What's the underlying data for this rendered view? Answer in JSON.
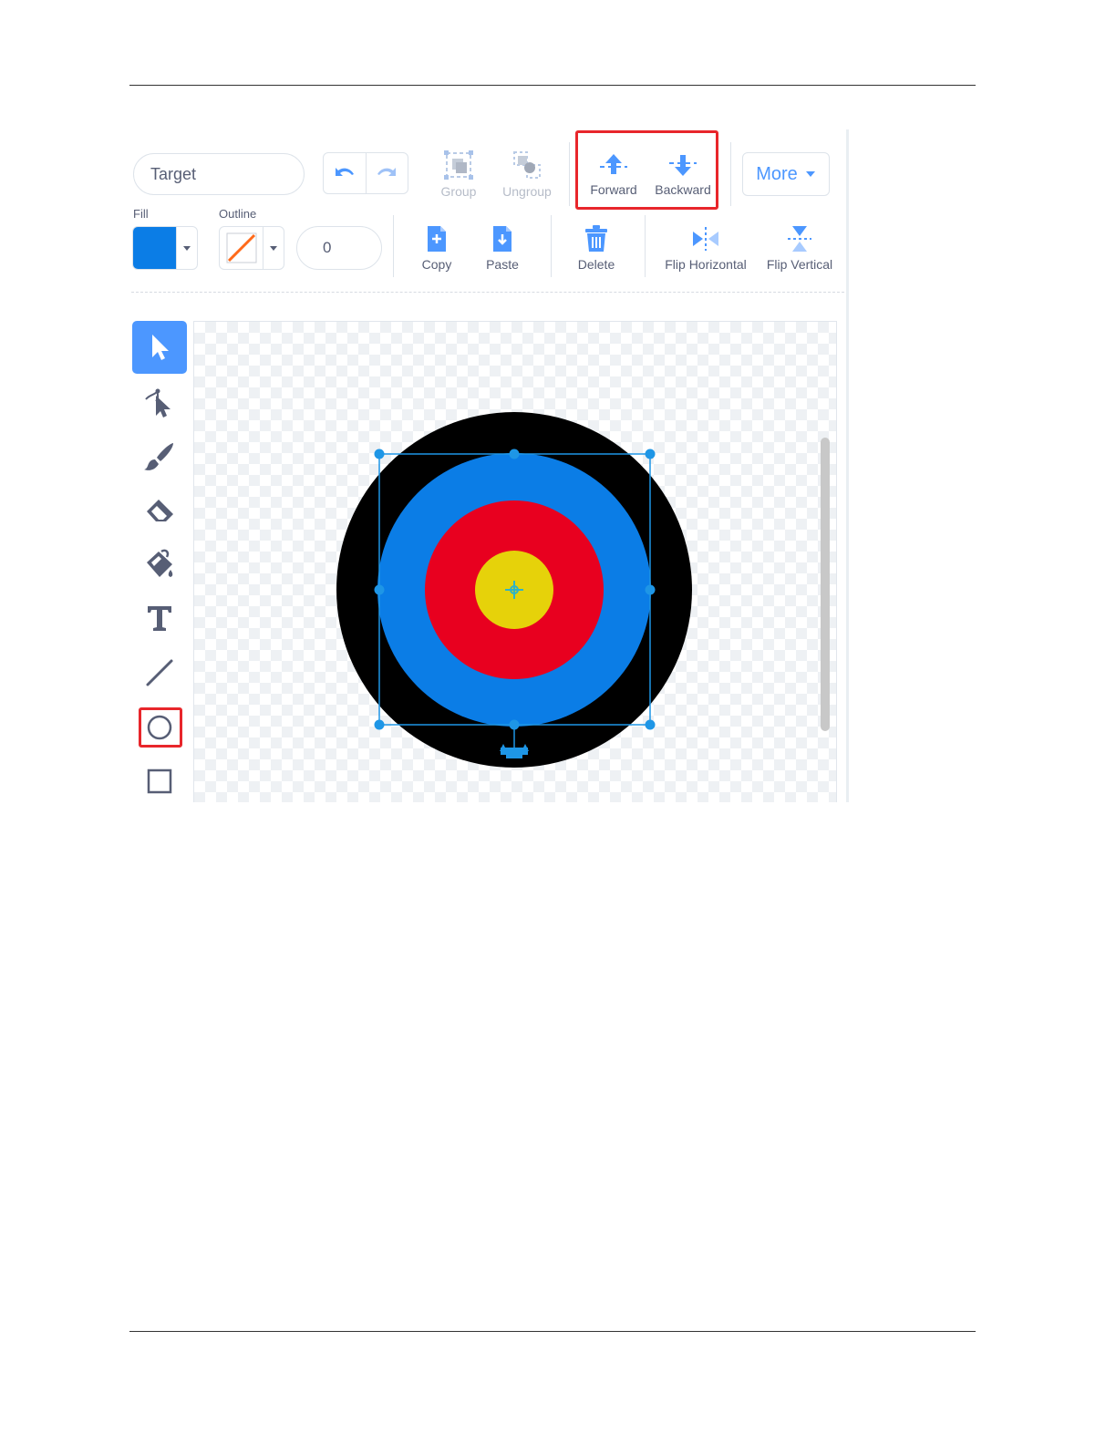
{
  "costume_name": "Target",
  "toolbar": {
    "group_label": "Group",
    "ungroup_label": "Ungroup",
    "forward_label": "Forward",
    "backward_label": "Backward",
    "more_label": "More",
    "copy_label": "Copy",
    "paste_label": "Paste",
    "delete_label": "Delete",
    "flip_horizontal_label": "Flip Horizontal",
    "flip_vertical_label": "Flip Vertical"
  },
  "fill": {
    "label": "Fill",
    "color": "#0b7de6"
  },
  "outline": {
    "label": "Outline",
    "color": "none",
    "width": "0"
  },
  "tools": [
    "select",
    "reshape",
    "brush",
    "eraser",
    "fill",
    "text",
    "line",
    "circle",
    "rectangle"
  ],
  "active_tool": "select",
  "highlighted_tool": "circle",
  "target": {
    "rings": [
      {
        "name": "outer",
        "color": "#000000"
      },
      {
        "name": "second",
        "color": "#0b7de6"
      },
      {
        "name": "third",
        "color": "#e8001f"
      },
      {
        "name": "center",
        "color": "#e6d20a"
      }
    ],
    "selected_ring": "second"
  },
  "colors": {
    "accent": "#4c97ff",
    "highlight": "#e8262b"
  }
}
